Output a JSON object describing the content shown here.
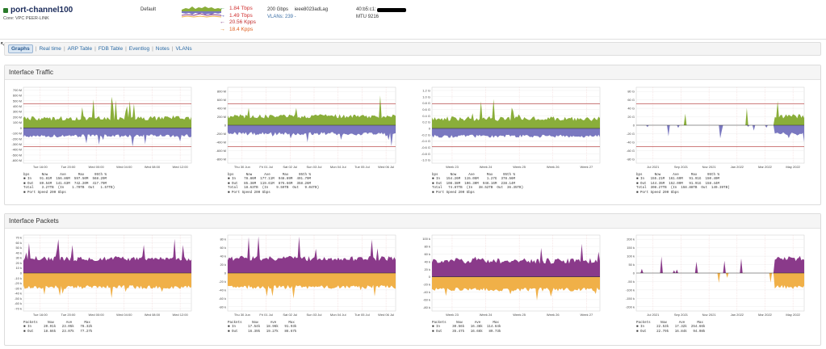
{
  "port": {
    "title": "port-channel100",
    "description": "Core: VPC PEER-LINK",
    "policy": "Default",
    "rates": [
      {
        "arrow": "←",
        "value": "1.84 Tbps",
        "color": "#d03030",
        "arrow_color": "#2a8a2a"
      },
      {
        "arrow": "→",
        "value": "1.49 Tbps",
        "color": "#d03030",
        "arrow_color": "#2a2aa0"
      },
      {
        "arrow": "←",
        "value": "20.56 Kpps",
        "color": "#c02a2a",
        "arrow_color": "#7a2a7a"
      },
      {
        "arrow": "→",
        "value": "18.4 Kpps",
        "color": "#e06020",
        "arrow_color": "#e08020"
      }
    ],
    "speed_text": "200 Gbps",
    "type_text": "ieee8023adLag",
    "vlans_text": "VLANs: 239 -",
    "mac_prefix": "40:b5:c1:",
    "mtu_text": "MTU 9216"
  },
  "nav": {
    "tabs": [
      "Graphs",
      "Real time",
      "ARP Table",
      "FDB Table",
      "Eventlog",
      "Notes",
      "VLANs"
    ],
    "active": "Graphs"
  },
  "panels": [
    {
      "title": "Interface Traffic"
    },
    {
      "title": "Interface Packets"
    }
  ],
  "colors": {
    "in_traffic": "#8aae3a",
    "out_traffic": "#7a78c0",
    "in_packets": "#8a3a8a",
    "out_packets": "#f0b048",
    "limit": "#b03030"
  },
  "graphs": {
    "traffic": [
      {
        "ylabels": [
          "700 M",
          "600 M",
          "500 M",
          "400 M",
          "300 M",
          "200 M",
          "100 M",
          "0",
          "-100 M",
          "-200 M",
          "-300 M",
          "-400 M",
          "-500 M",
          "-600 M"
        ],
        "xlabels": [
          "Tue 16:00",
          "Tue 20:00",
          "Wed 00:00",
          "Wed 04:00",
          "Wed 08:00",
          "Wed 12:00"
        ],
        "legend": "bps      Now      Ave      Max     95th %\n■ In    91.81M  156.86M  597.50M  568.29M\n■ Out   89.54M  141.63M  742.20M  417.79M\nTotal    3.27TB  (In    1.70TB  Out   1.57TB)\n■ Port Speed 200 Gbps"
      },
      {
        "ylabels": [
          "800 M",
          "600 M",
          "400 M",
          "200 M",
          "0",
          "-200 M",
          "-400 M",
          "-600 M",
          "-800 M"
        ],
        "xlabels": [
          "Thu 30 Jun",
          "Fri 01 Jul",
          "Sat 02 Jul",
          "Sun 03 Jul",
          "Mon 04 Jul",
          "Tue 05 Jul",
          "Wed 06 Jul"
        ],
        "legend": "bps      Now      Ave      Max     95th %\n■ In    78.86M  177.11M  948.89M  491.79M\n■ Out   85.38M  119.61M  876.66M  358.26M\nTotal   18.63TB  (In    9.59TB  Out   9.04TB)\n■ Port Speed 200 Gbps"
      },
      {
        "ylabels": [
          "1.2 G",
          "1.0 G",
          "0.8 G",
          "0.6 G",
          "0.4 G",
          "0.2 G",
          "0",
          "-0.2 G",
          "-0.4 G",
          "-0.6 G",
          "-0.8 G",
          "-1.0 G"
        ],
        "xlabels": [
          "Week 23",
          "Week 24",
          "Week 25",
          "Week 26",
          "Week 27"
        ],
        "legend": "bps      Now      Ave      Max     95th %\n■ In   154.26M  115.05M    1.27G  378.56M\n■ Out  108.38M  106.30M  946.16M  238.14M\nTotal   74.87TB  (In   38.52TB  Out  36.35TB)\n■ Port Speed 200 Gbps"
      },
      {
        "ylabels": [
          "80 G",
          "60 G",
          "40 G",
          "20 G",
          "0",
          "-20 G",
          "-40 G",
          "-60 G",
          "-80 G"
        ],
        "xlabels": [
          "Jul 2021",
          "Sep 2021",
          "Nov 2021",
          "Jan 2022",
          "Mar 2022",
          "May 2022"
        ],
        "legend": "bps      Now      Ave      Max     95th %\n■ In   155.21M  161.69M   91.91G  150.49M\n■ Out  144.35M  152.09M   91.91G  158.44M\nTotal  308.27TB  (In  158.88TB  Out  149.39TB)\n■ Port Speed 200 Gbps"
      }
    ],
    "packets": [
      {
        "ylabels": [
          "70 k",
          "60 k",
          "50 k",
          "40 k",
          "30 k",
          "20 k",
          "10 k",
          "0",
          "-10 k",
          "-20 k",
          "-30 k",
          "-40 k",
          "-50 k",
          "-60 k",
          "-70 k"
        ],
        "xlabels": [
          "Tue 16:00",
          "Tue 20:00",
          "Wed 00:00",
          "Wed 04:00",
          "Wed 08:00",
          "Wed 12:00"
        ],
        "legend": "Packets     Now      Ave      Max\n■ In      20.91k   23.05k   78.32k\n■ Out     18.66k   23.07k   77.27k"
      },
      {
        "ylabels": [
          "80 k",
          "60 k",
          "40 k",
          "20 k",
          "0",
          "-20 k",
          "-40 k",
          "-60 k",
          "-80 k"
        ],
        "xlabels": [
          "Thu 30 Jun",
          "Fri 01 Jul",
          "Sat 02 Jul",
          "Sun 03 Jul",
          "Mon 04 Jul",
          "Tue 05 Jul",
          "Wed 06 Jul"
        ],
        "legend": "Packets     Now      Ave      Max\n■ In      17.54k   18.96k   91.93k\n■ Out     16.39k   19.27k   86.67k"
      },
      {
        "ylabels": [
          "100 k",
          "80 k",
          "60 k",
          "40 k",
          "20 k",
          "0",
          "-20 k",
          "-40 k",
          "-60 k",
          "-80 k"
        ],
        "xlabels": [
          "Week 23",
          "Week 24",
          "Week 25",
          "Week 26",
          "Week 27"
        ],
        "legend": "Packets     Now      Ave      Max\n■ In      30.56k   16.38k  114.64k\n■ Out     35.47k   16.66k   89.73k"
      },
      {
        "ylabels": [
          "200 k",
          "150 k",
          "100 k",
          "50 k",
          "0",
          "-50 k",
          "-100 k",
          "-150 k",
          "-200 k"
        ],
        "xlabels": [
          "Jul 2021",
          "Sep 2021",
          "Nov 2021",
          "Jan 2022",
          "Mar 2022",
          "May 2022"
        ],
        "legend": "Packets     Now      Ave      Max\n■ In      22.53k   17.32k  254.66k\n■ Out     22.79k   16.84k   94.08k"
      }
    ]
  }
}
